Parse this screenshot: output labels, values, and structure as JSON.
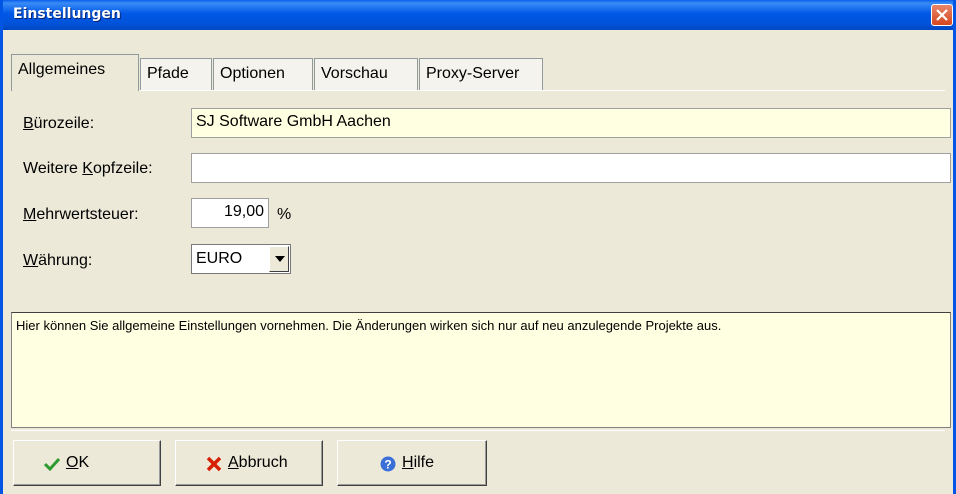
{
  "window": {
    "title": "Einstellungen"
  },
  "tabs": [
    {
      "label": "Allgemeines",
      "active": true
    },
    {
      "label": "Pfade"
    },
    {
      "label": "Optionen"
    },
    {
      "label": "Vorschau"
    },
    {
      "label": "Proxy-Server"
    }
  ],
  "form": {
    "buerozeile": {
      "label_u": "B",
      "label_rest": "ürozeile:",
      "value": "SJ Software GmbH Aachen"
    },
    "kopfzeile": {
      "label_pre": "Weitere ",
      "label_u": "K",
      "label_rest": "opfzeile:",
      "value": ""
    },
    "mwst": {
      "label_u": "M",
      "label_rest": "ehrwertsteuer:",
      "value": "19,00",
      "unit": "%"
    },
    "waehrung": {
      "label_u": "W",
      "label_rest": "ährung:",
      "value": "EURO"
    }
  },
  "info_text": "Hier können Sie allgemeine Einstellungen vornehmen. Die Änderungen wirken sich nur auf neu anzulegende Projekte aus.",
  "buttons": {
    "ok": {
      "u": "O",
      "rest": "K"
    },
    "cancel": {
      "u": "A",
      "rest": "bbruch"
    },
    "help": {
      "u": "H",
      "rest": "ilfe"
    }
  },
  "colors": {
    "titlebar": "#0058E6",
    "face": "#ECE9D8",
    "highlight_field": "#FFFFE1",
    "ok_icon": "#2E9A2E",
    "cancel_icon": "#D81E05",
    "help_icon": "#3A6FD8"
  }
}
